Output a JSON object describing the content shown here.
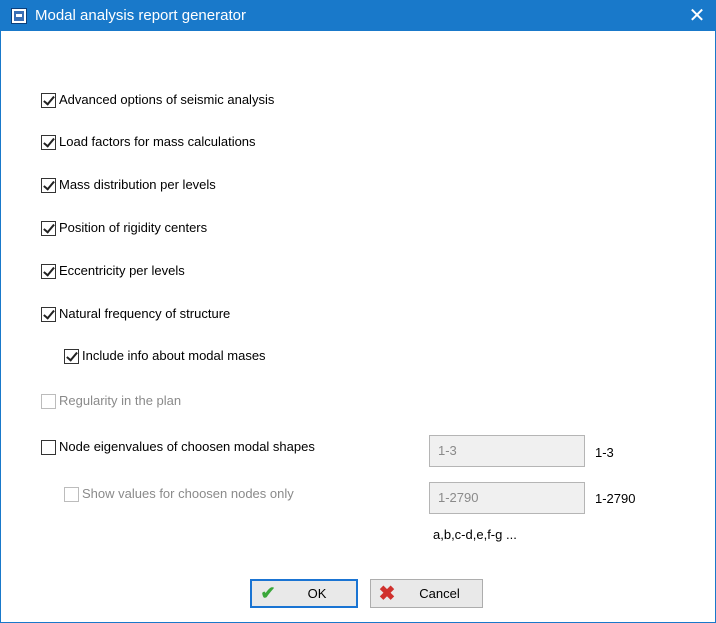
{
  "window": {
    "title": "Modal analysis report generator",
    "close_glyph": "✕",
    "app_icon": "report-app-icon"
  },
  "options": [
    {
      "label": "Advanced options of seismic analysis",
      "checked": true,
      "enabled": true
    },
    {
      "label": "Load factors for mass calculations",
      "checked": true,
      "enabled": true
    },
    {
      "label": "Mass distribution per levels",
      "checked": true,
      "enabled": true
    },
    {
      "label": "Position of rigidity centers",
      "checked": true,
      "enabled": true
    },
    {
      "label": "Eccentricity per levels",
      "checked": true,
      "enabled": true
    },
    {
      "label": "Natural frequency of structure",
      "checked": true,
      "enabled": true
    },
    {
      "label": "Include info about modal mases",
      "checked": true,
      "enabled": true
    },
    {
      "label": "Regularity in the plan",
      "checked": false,
      "enabled": false
    },
    {
      "label": "Node eigenvalues of choosen modal shapes",
      "checked": false,
      "enabled": true
    },
    {
      "label": "Show values for choosen nodes only",
      "checked": false,
      "enabled": false
    }
  ],
  "modal_shapes_field": {
    "value": "1-3",
    "range_label": "1-3"
  },
  "nodes_field": {
    "value": "1-2790",
    "range_label": "1-2790"
  },
  "format_hint": "a,b,c-d,e,f-g ...",
  "buttons": {
    "ok": {
      "label": "OK",
      "icon": "checkmark-icon"
    },
    "cancel": {
      "label": "Cancel",
      "icon": "x-icon"
    }
  },
  "colors": {
    "title_bar": "#1979ca",
    "ok_icon": "#3aa73a",
    "cancel_icon": "#d0312d",
    "default_button_border": "#1a74d3"
  }
}
